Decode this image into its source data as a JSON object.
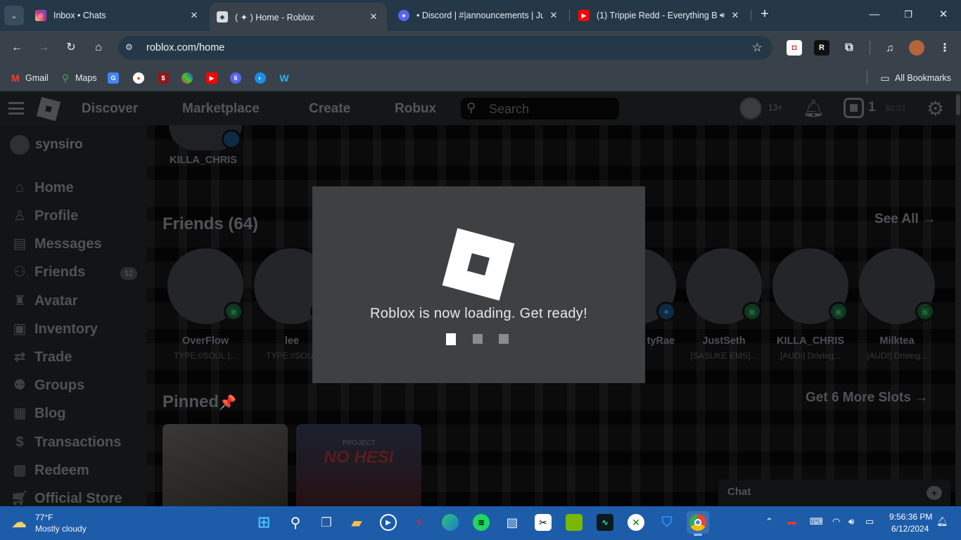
{
  "browser": {
    "tabs": [
      {
        "title": "Inbox • Chats",
        "favicon_color": "#d62976"
      },
      {
        "title": "( ✦ ) Home - Roblox",
        "favicon_color": "#d7dbde"
      },
      {
        "title": "• Discord | #|announcements | Juj",
        "favicon_color": "#5865f2"
      },
      {
        "title": "(1) Trippie Redd - Everything B",
        "favicon_color": "#ff0000"
      }
    ],
    "new_tab": "+",
    "url": "roblox.com/home",
    "bookmarks": [
      {
        "label": "Gmail",
        "icon": "gmail-icon",
        "color": "#ea4335"
      },
      {
        "label": "Maps",
        "icon": "maps-icon",
        "color": "#34a853"
      }
    ],
    "all_bookmarks": "All Bookmarks"
  },
  "roblox": {
    "nav": [
      "Discover",
      "Marketplace",
      "Create",
      "Robux"
    ],
    "search_placeholder": "Search",
    "age_label": "13+",
    "robux_count": "1",
    "robux_balance": "$0.01",
    "sidebar": {
      "username": "synsiro",
      "items": [
        {
          "label": "Home",
          "icon": "home-icon"
        },
        {
          "label": "Profile",
          "icon": "profile-icon"
        },
        {
          "label": "Messages",
          "icon": "messages-icon"
        },
        {
          "label": "Friends",
          "icon": "friends-icon",
          "badge": "12"
        },
        {
          "label": "Avatar",
          "icon": "avatar-icon"
        },
        {
          "label": "Inventory",
          "icon": "inventory-icon"
        },
        {
          "label": "Trade",
          "icon": "trade-icon"
        },
        {
          "label": "Groups",
          "icon": "groups-icon"
        },
        {
          "label": "Blog",
          "icon": "blog-icon"
        },
        {
          "label": "Transactions",
          "icon": "transactions-icon"
        },
        {
          "label": "Redeem",
          "icon": "redeem-icon"
        },
        {
          "label": "Official Store",
          "icon": "store-icon"
        }
      ]
    },
    "top_friend_name": "KILLA_CHRIS",
    "friends_heading": "Friends (64)",
    "see_all": "See All →",
    "friends": [
      {
        "name": "OverFlow",
        "status": "TYPE://SOUL [..."
      },
      {
        "name": "lee",
        "status": "TYPE://SOUL"
      },
      {
        "name": "tyRae",
        "status": ""
      },
      {
        "name": "JustSeth",
        "status": "[SASUKE EMS]..."
      },
      {
        "name": "KILLA_CHRIS",
        "status": "[AUDI] Driving..."
      },
      {
        "name": "Milktea",
        "status": "[AUDI] Driving..."
      }
    ],
    "pinned_heading": "Pinned",
    "pinned_emoji": "📌",
    "more_slots": "Get 6 More Slots →",
    "pinned_card_text": [
      "PROJECT",
      "NO HESI"
    ],
    "chat_label": "Chat"
  },
  "modal": {
    "message": "Roblox is now loading. Get ready!"
  },
  "taskbar": {
    "temperature": "77°F",
    "weather": "Mostly cloudy",
    "time": "9:56:36 PM",
    "date": "6/12/2024"
  },
  "colors": {
    "taskbar": "#1d5ca9",
    "chrome_dark": "#253848",
    "chrome_toolbar": "#39424b",
    "modal_bg": "#3f4042",
    "online_game_green": "#1c6b3a"
  }
}
